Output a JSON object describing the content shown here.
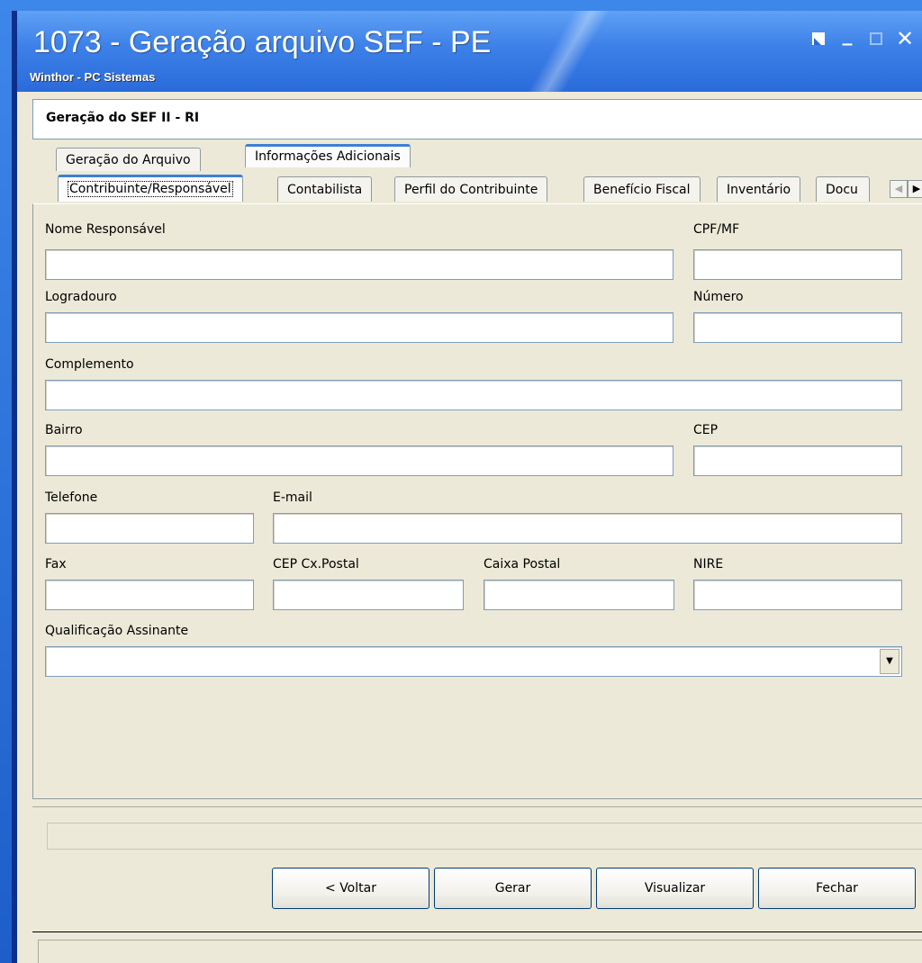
{
  "window": {
    "title": "1073 - Geração arquivo SEF - PE",
    "subtitle": "Winthor - PC Sistemas",
    "controls": [
      "restore-icon",
      "minimize-icon",
      "maximize-icon",
      "close-icon"
    ]
  },
  "header": {
    "title": "Geração do SEF II - RI"
  },
  "outer_tabs": [
    {
      "label": "Geração do Arquivo",
      "active": false
    },
    {
      "label": "Informações Adicionais",
      "active": true
    }
  ],
  "inner_tabs": [
    {
      "label": "Contribuinte/Responsável",
      "active": true
    },
    {
      "label": "Contabilista",
      "active": false
    },
    {
      "label": "Perfil do Contribuinte",
      "active": false
    },
    {
      "label": "Benefício Fiscal",
      "active": false
    },
    {
      "label": "Inventário",
      "active": false
    },
    {
      "label": "Docu",
      "active": false
    }
  ],
  "form": {
    "nome_responsavel": {
      "label": "Nome Responsável",
      "value": ""
    },
    "cpf_mf": {
      "label": "CPF/MF",
      "value": ""
    },
    "logradouro": {
      "label": "Logradouro",
      "value": ""
    },
    "numero": {
      "label": "Número",
      "value": ""
    },
    "complemento": {
      "label": "Complemento",
      "value": ""
    },
    "bairro": {
      "label": "Bairro",
      "value": ""
    },
    "cep": {
      "label": "CEP",
      "value": ""
    },
    "telefone": {
      "label": "Telefone",
      "value": ""
    },
    "email": {
      "label": "E-mail",
      "value": ""
    },
    "fax": {
      "label": "Fax",
      "value": ""
    },
    "cep_cx_postal": {
      "label": "CEP Cx.Postal",
      "value": ""
    },
    "caixa_postal": {
      "label": "Caixa Postal",
      "value": ""
    },
    "nire": {
      "label": "NIRE",
      "value": ""
    },
    "qualificacao_assinante": {
      "label": "Qualificação Assinante",
      "value": ""
    }
  },
  "buttons": {
    "voltar": "< Voltar",
    "gerar": "Gerar",
    "visualizar": "Visualizar",
    "fechar": "Fechar"
  }
}
